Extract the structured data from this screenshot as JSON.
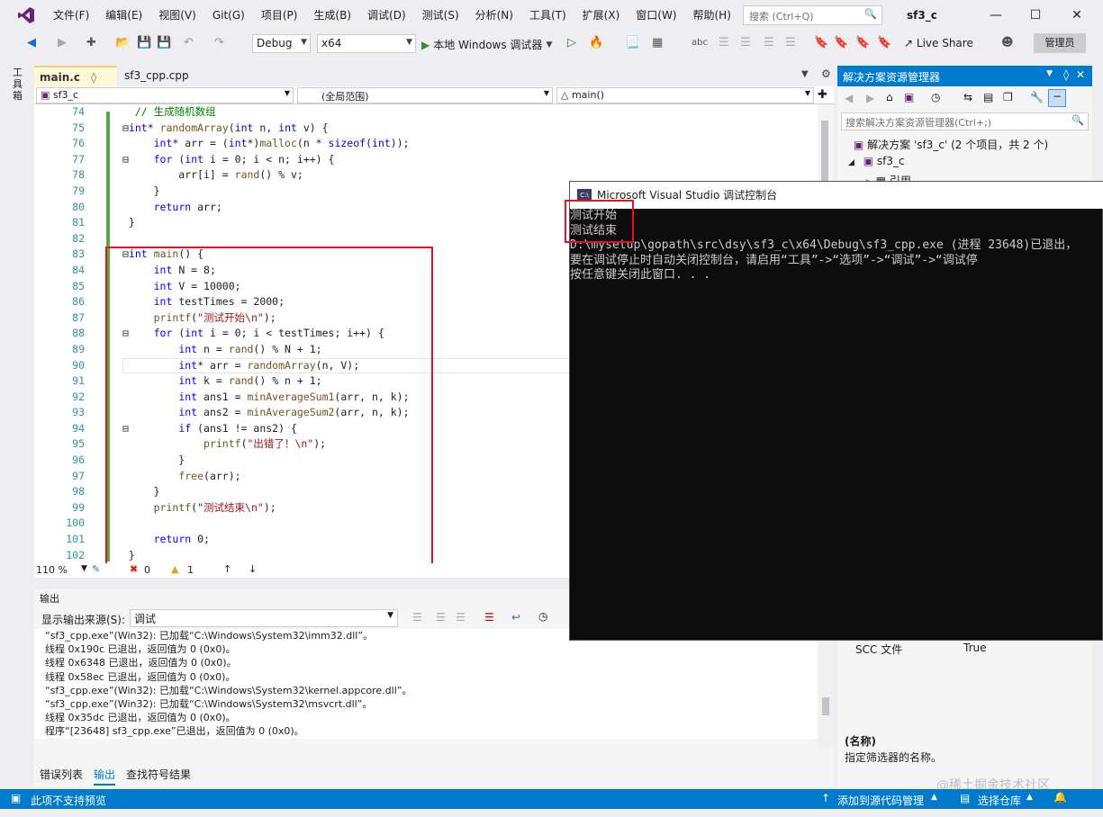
{
  "menubar": {
    "items": [
      "文件(F)",
      "编辑(E)",
      "视图(V)",
      "Git(G)",
      "项目(P)",
      "生成(B)",
      "调试(D)",
      "测试(S)",
      "分析(N)",
      "工具(T)",
      "扩展(X)",
      "窗口(W)",
      "帮助(H)"
    ],
    "search_placeholder": "搜索 (Ctrl+Q)",
    "window_title": "sf3_c"
  },
  "toolbar": {
    "config": "Debug",
    "platform": "x64",
    "run_label": "本地 Windows 调试器",
    "live_share": "Live Share",
    "admin": "管理员"
  },
  "toolbox": {
    "label": "工具箱"
  },
  "tabs": {
    "active": "main.c",
    "other": "sf3_cpp.cpp"
  },
  "navbar": {
    "project": "sf3_c",
    "scope": "(全局范围)",
    "member": "main()"
  },
  "editor": {
    "line_numbers": [
      "74",
      "75",
      "76",
      "77",
      "78",
      "79",
      "80",
      "81",
      "82",
      "83",
      "84",
      "85",
      "86",
      "87",
      "88",
      "89",
      "90",
      "91",
      "92",
      "93",
      "94",
      "95",
      "96",
      "97",
      "98",
      "99",
      "100",
      "101",
      "102"
    ],
    "zoom": "110 %",
    "errors": "0",
    "warnings": "1"
  },
  "output": {
    "title": "输出",
    "source_label": "显示输出来源(S):",
    "source_value": "调试",
    "lines": [
      "“sf3_cpp.exe”(Win32): 已加载“C:\\Windows\\System32\\imm32.dll”。",
      "线程 0x190c 已退出，返回值为 0 (0x0)。",
      "线程 0x6348 已退出，返回值为 0 (0x0)。",
      "线程 0x58ec 已退出，返回值为 0 (0x0)。",
      "“sf3_cpp.exe”(Win32): 已加载“C:\\Windows\\System32\\kernel.appcore.dll”。",
      "“sf3_cpp.exe”(Win32): 已加载“C:\\Windows\\System32\\msvcrt.dll”。",
      "线程 0x35dc 已退出，返回值为 0 (0x0)。",
      "程序“[23648] sf3_cpp.exe”已退出，返回值为 0 (0x0)。"
    ],
    "tabs": [
      "错误列表",
      "输出",
      "查找符号结果"
    ]
  },
  "solution": {
    "title": "解决方案资源管理器",
    "search_placeholder": "搜索解决方案资源管理器(Ctrl+;)",
    "root": "解决方案 'sf3_c' (2 个项目，共 2 个)",
    "project": "sf3_c",
    "child": "引用",
    "prop_key": "SCC 文件",
    "prop_val": "True",
    "prop_name": "(名称)",
    "prop_desc": "指定筛选器的名称。"
  },
  "console": {
    "title": "Microsoft Visual Studio 调试控制台",
    "icon_text": "C:\\",
    "lines": [
      "测试开始",
      "测试结束",
      "",
      "D:\\mysetup\\gopath\\src\\dsy\\sf3_c\\x64\\Debug\\sf3_cpp.exe (进程 23648)已退出，",
      "要在调试停止时自动关闭控制台，请启用“工具”->“选项”->“调试”->“调试停",
      "按任意键关闭此窗口. . ."
    ]
  },
  "statusbar": {
    "left": "此项不支持预览",
    "source_control": "添加到源代码管理",
    "repo": "选择仓库"
  },
  "watermark": "@稀土掘金技术社区"
}
